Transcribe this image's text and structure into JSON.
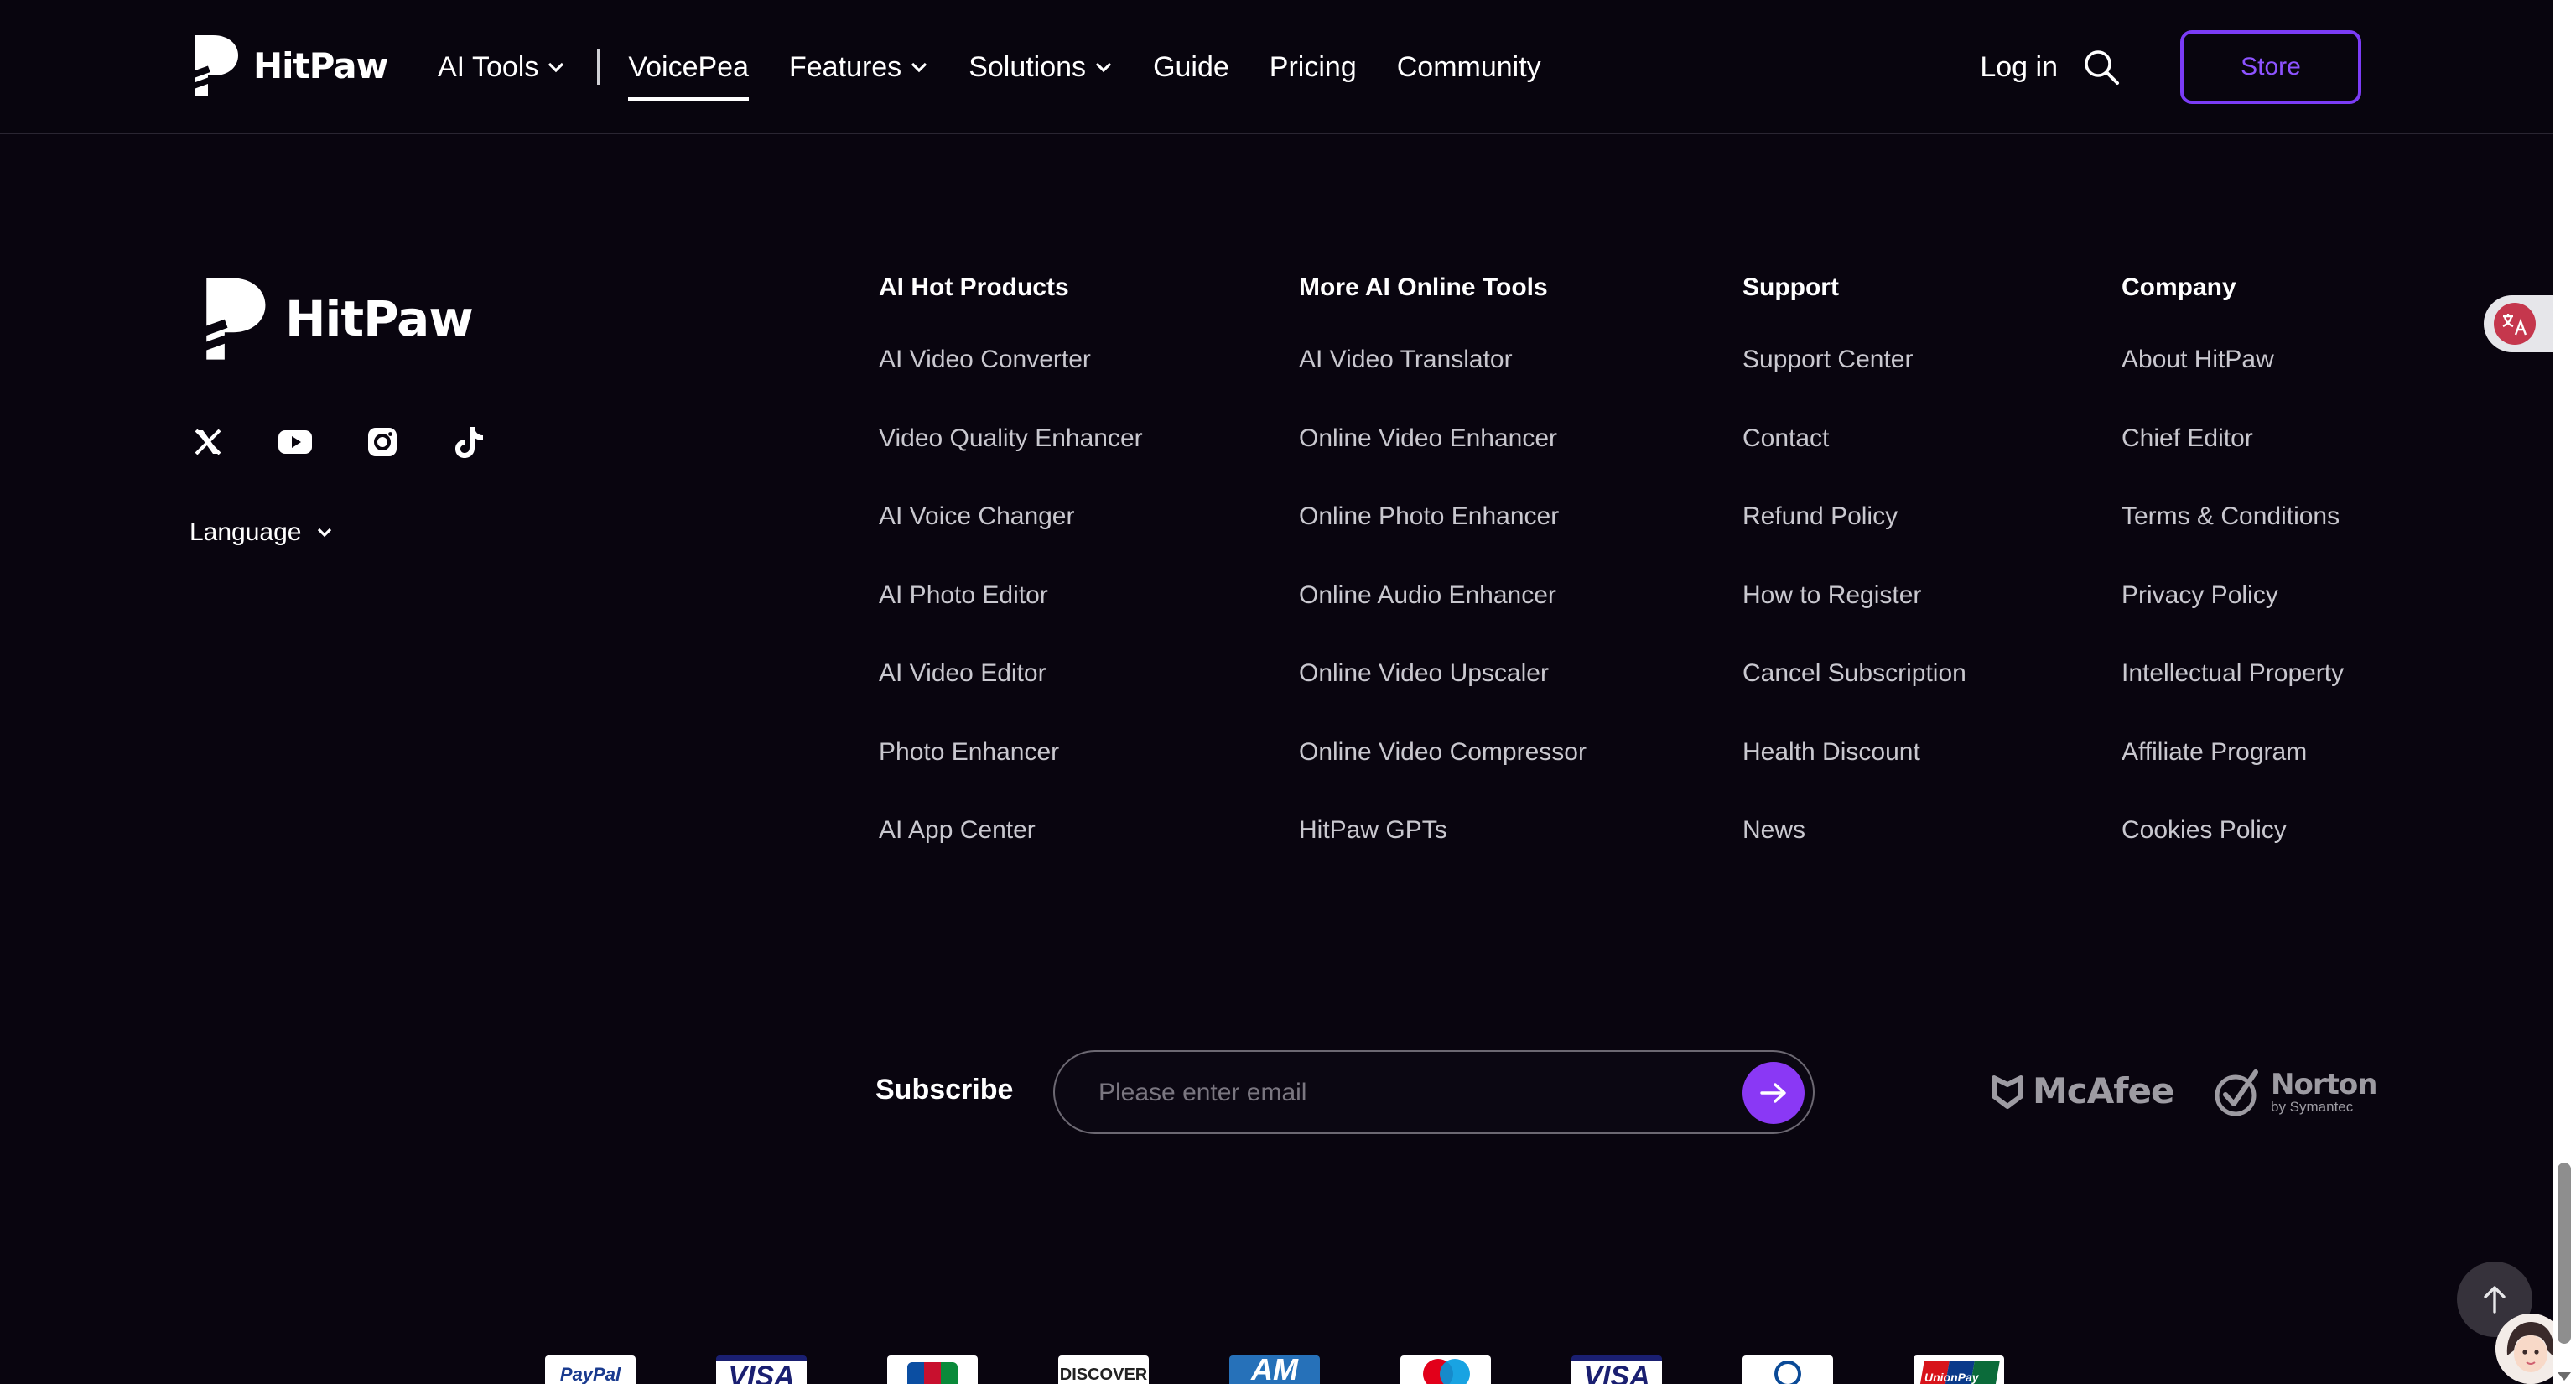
{
  "brand": {
    "name": "HitPaw"
  },
  "nav": {
    "items": [
      {
        "label": "AI Tools",
        "dropdown": true
      },
      {
        "label": "VoicePea",
        "dropdown": false,
        "active": true
      },
      {
        "label": "Features",
        "dropdown": true
      },
      {
        "label": "Solutions",
        "dropdown": true
      },
      {
        "label": "Guide",
        "dropdown": false
      },
      {
        "label": "Pricing",
        "dropdown": false
      },
      {
        "label": "Community",
        "dropdown": false
      }
    ],
    "login": "Log in",
    "store": "Store"
  },
  "footer": {
    "socials": [
      "x-icon",
      "youtube-icon",
      "instagram-icon",
      "tiktok-icon"
    ],
    "language": "Language",
    "columns": [
      {
        "title": "AI Hot Products",
        "links": [
          "AI Video Converter",
          "Video Quality Enhancer",
          "AI Voice Changer",
          "AI Photo Editor",
          "AI Video Editor",
          "Photo Enhancer",
          "AI App Center"
        ]
      },
      {
        "title": "More AI Online Tools",
        "links": [
          "AI Video Translator",
          "Online Video Enhancer",
          "Online Photo Enhancer",
          "Online Audio Enhancer",
          "Online Video Upscaler",
          "Online Video Compressor",
          "HitPaw GPTs"
        ]
      },
      {
        "title": "Support",
        "links": [
          "Support Center",
          "Contact",
          "Refund Policy",
          "How to Register",
          "Cancel Subscription",
          "Health Discount",
          "News"
        ]
      },
      {
        "title": "Company",
        "links": [
          "About HitPaw",
          "Chief Editor",
          "Terms & Conditions",
          "Privacy Policy",
          "Intellectual Property",
          "Affiliate Program",
          "Cookies Policy"
        ]
      }
    ],
    "subscribe": {
      "label": "Subscribe",
      "placeholder": "Please enter email",
      "value": ""
    },
    "badges": {
      "mcafee": "McAfee",
      "norton": "Norton",
      "norton_sub": "by Symantec"
    },
    "payments": [
      {
        "name": "PayPal",
        "icon": "paypal-icon",
        "color": "#1a3b8f"
      },
      {
        "name": "VISA",
        "icon": "visa-icon",
        "color": "#1a1f71"
      },
      {
        "name": "JCB",
        "icon": "jcb-icon",
        "color": "#c8102e"
      },
      {
        "name": "DISCOVER",
        "icon": "discover-icon",
        "color": "#222222"
      },
      {
        "name": "AM",
        "icon": "amex-icon",
        "color": "#ffffff",
        "bg": "#2671b9"
      },
      {
        "name": "",
        "icon": "maestro-icon",
        "color": "#e2001a"
      },
      {
        "name": "VISA",
        "icon": "visa-icon",
        "color": "#1a1f71"
      },
      {
        "name": "",
        "icon": "diners-icon",
        "color": "#0a4a97"
      },
      {
        "name": "UnionPay",
        "icon": "unionpay-icon",
        "color": "#0b6b3a"
      }
    ]
  },
  "colors": {
    "background": "#09050f",
    "accent": "#8a38f5",
    "store_border": "#7b3cf6",
    "link": "#c9c8cf"
  }
}
